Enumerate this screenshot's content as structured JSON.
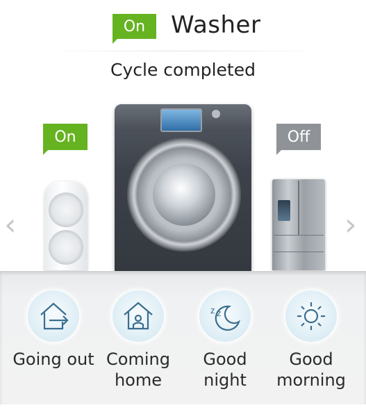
{
  "header": {
    "badge": "On",
    "title": "Washer"
  },
  "status": "Cycle completed",
  "devices": [
    {
      "name": "air-conditioner",
      "badge": "On",
      "badge_color": "#66b321"
    },
    {
      "name": "washer"
    },
    {
      "name": "refrigerator",
      "badge": "Off",
      "badge_color": "#8f9397"
    }
  ],
  "nav": {
    "prev": "‹",
    "next": "›"
  },
  "modes": [
    {
      "label_line1": "Going out",
      "label_line2": "",
      "icon": "house-exit-icon"
    },
    {
      "label_line1": "Coming",
      "label_line2": "home",
      "icon": "house-person-icon"
    },
    {
      "label_line1": "Good",
      "label_line2": "night",
      "icon": "moon-zz-icon"
    },
    {
      "label_line1": "Good",
      "label_line2": "morning",
      "icon": "sun-icon"
    }
  ],
  "colors": {
    "accent_green": "#66b321",
    "off_grey": "#8f9397",
    "icon_blue": "#3a6e8f"
  }
}
